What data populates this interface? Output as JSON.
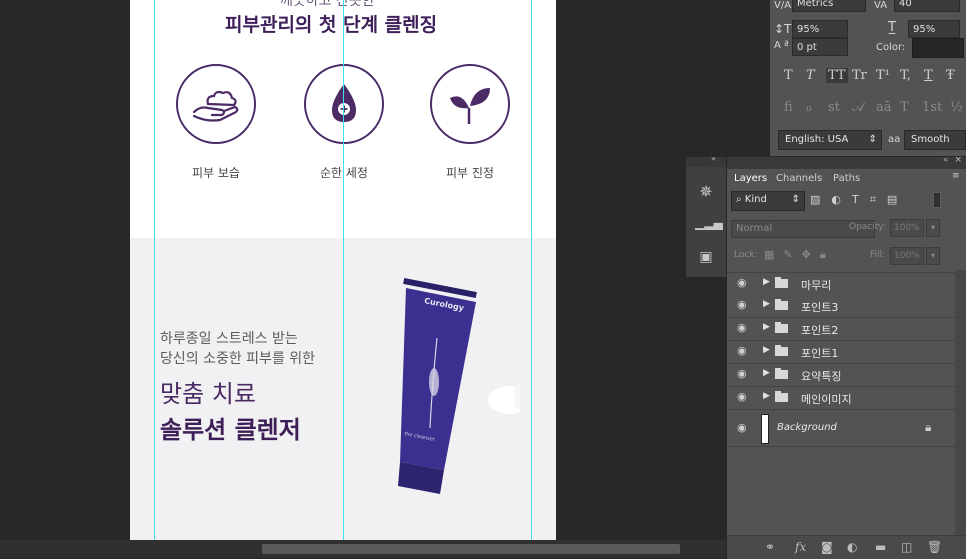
{
  "canvas": {
    "heading_small": "깨끗하고 산뜻한",
    "heading_big": "피부관리의 첫 단계 클렌징",
    "icons": [
      {
        "label": "피부 보습",
        "icon": "hand-foam-icon"
      },
      {
        "label": "순한 세정",
        "icon": "drop-plus-icon"
      },
      {
        "label": "피부 진정",
        "icon": "leaf-sprout-icon"
      }
    ],
    "promo_line1": "하루종일 스트레스 받는",
    "promo_line2": "당신의 소중한 피부를 위한",
    "promo_title1": "맞춤 치료",
    "promo_title2": "솔루션 클렌저",
    "product_brand": "Curology",
    "product_sub": "the cleanser"
  },
  "character_panel": {
    "metrics": "Metrics",
    "tracking": "40",
    "vertical_scale": "95%",
    "horizontal_scale": "95%",
    "baseline_shift": "0 pt",
    "color_label": "Color:",
    "type_buttons": [
      "T",
      "T",
      "TT",
      "Tr",
      "T¹",
      "T,",
      "T",
      "Ŧ"
    ],
    "ligature_buttons": [
      "fi",
      "ℴ",
      "st",
      "𝒜",
      "aā",
      "T",
      "1st",
      "½"
    ],
    "language": "English: USA",
    "antialias_label": "aa",
    "antialias": "Smooth"
  },
  "layers_panel": {
    "tabs": [
      "Layers",
      "Channels",
      "Paths"
    ],
    "filter_kind": "Kind",
    "blend_mode": "Normal",
    "opacity_label": "Opacity:",
    "opacity_value": "100%",
    "lock_label": "Lock:",
    "fill_label": "Fill:",
    "fill_value": "100%",
    "layers": [
      {
        "name": "마무리",
        "type": "group"
      },
      {
        "name": "포인트3",
        "type": "group"
      },
      {
        "name": "포인트2",
        "type": "group"
      },
      {
        "name": "포인트1",
        "type": "group"
      },
      {
        "name": "요약특징",
        "type": "group"
      },
      {
        "name": "메인이미지",
        "type": "group"
      }
    ],
    "background_layer": "Background"
  },
  "colors": {
    "brand_purple": "#3f1f5a",
    "guide_cyan": "#3de2ee",
    "workspace": "#282828",
    "panel": "#535353"
  }
}
